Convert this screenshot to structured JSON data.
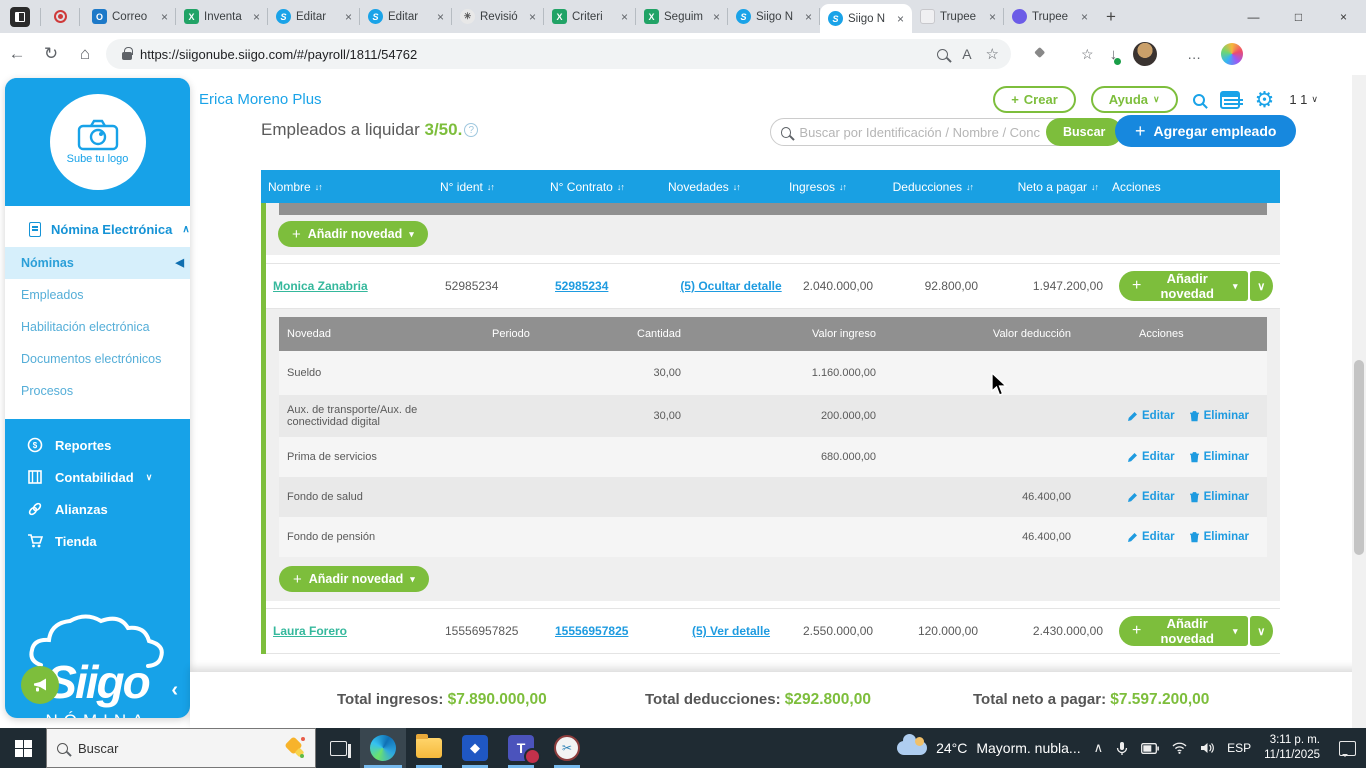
{
  "colors": {
    "siigo_blue": "#17A2E8",
    "siigo_green": "#7DBE3C",
    "table_header_blue": "#19A0E3",
    "detail_header_gray": "#909090",
    "link_blue": "#1E9BE0",
    "name_link_teal": "#35B89C",
    "agregar_button_blue": "#1788DE"
  },
  "browser": {
    "tabs": [
      {
        "label": "Correo"
      },
      {
        "label": "Inventa"
      },
      {
        "label": "Editar"
      },
      {
        "label": "Editar"
      },
      {
        "label": "Revisió"
      },
      {
        "label": "Criteri"
      },
      {
        "label": "Seguim"
      },
      {
        "label": "Siigo N"
      },
      {
        "label": "Siigo N"
      },
      {
        "label": "Trupee"
      },
      {
        "label": "Trupee"
      }
    ],
    "favicon_letters": {
      "outlook": "O",
      "excel": "X",
      "siigo": "S",
      "openai": "✳",
      "trupee_gray": "▣",
      "trupee_purple": "◉"
    },
    "url": "https://siigonube.siigo.com/#/payroll/1811/54762"
  },
  "header": {
    "company": "Erica Moreno Plus",
    "crear": "Crear",
    "ayuda": "Ayuda",
    "org_count": "1 1"
  },
  "toolbar": {
    "title": "Empleados a liquidar",
    "count": "3/50.",
    "search_placeholder": "Buscar por Identificación / Nombre / Conc",
    "buscar": "Buscar",
    "agregar": "Agregar empleado"
  },
  "table": {
    "headers": [
      "Nombre",
      "N° ident",
      "N° Contrato",
      "Novedades",
      "Ingresos",
      "Deducciones",
      "Neto a pagar",
      "Acciones"
    ],
    "add_novedad": "Añadir novedad",
    "rows": [
      {
        "name": "Monica Zanabria",
        "ident": "52985234",
        "contract": "52985234",
        "novelty": "(5) Ocultar detalle",
        "ingresos": "2.040.000,00",
        "deducciones": "92.800,00",
        "neto": "1.947.200,00"
      },
      {
        "name": "Laura Forero",
        "ident": "15556957825",
        "contract": "15556957825",
        "novelty": "(5) Ver detalle",
        "ingresos": "2.550.000,00",
        "deducciones": "120.000,00",
        "neto": "2.430.000,00"
      }
    ]
  },
  "detail": {
    "headers": [
      "Novedad",
      "Periodo",
      "Cantidad",
      "Valor ingreso",
      "Valor deducción",
      "Acciones"
    ],
    "rows": [
      {
        "name": "Sueldo",
        "qty": "30,00",
        "ingreso": "1.160.000,00",
        "deduccion": ""
      },
      {
        "name": "Aux. de transporte/Aux. de conectividad digital",
        "qty": "30,00",
        "ingreso": "200.000,00",
        "deduccion": ""
      },
      {
        "name": "Prima de servicios",
        "qty": "",
        "ingreso": "680.000,00",
        "deduccion": ""
      },
      {
        "name": "Fondo de salud",
        "qty": "",
        "ingreso": "",
        "deduccion": "46.400,00"
      },
      {
        "name": "Fondo de pensión",
        "qty": "",
        "ingreso": "",
        "deduccion": "46.400,00"
      }
    ],
    "editar": "Editar",
    "eliminar": "Eliminar"
  },
  "totals": {
    "ingresos_label": "Total ingresos:",
    "ingresos": "$7.890.000,00",
    "deducciones_label": "Total deducciones:",
    "deducciones": "$292.800,00",
    "neto_label": "Total neto a pagar:",
    "neto": "$7.597.200,00"
  },
  "sidebar": {
    "logo_placeholder": "Sube tu logo",
    "section": "Nómina Electrónica",
    "items": [
      "Nóminas",
      "Empleados",
      "Habilitación electrónica",
      "Documentos electrónicos",
      "Procesos"
    ],
    "lower_items": [
      "Reportes",
      "Contabilidad",
      "Alianzas",
      "Tienda"
    ],
    "brand": "Siigo",
    "brand_sub": "NÓMINA"
  },
  "taskbar": {
    "search": "Buscar",
    "weather_temp": "24°C",
    "weather_desc": "Mayorm. nubla...",
    "lang": "ESP",
    "time": "3:11 p. m.",
    "date": "11/11/2025"
  },
  "glyphs": {
    "close": "×",
    "plus": "+",
    "sort": "↓↑",
    "chevron_down": "∨",
    "chevron_up": "∧",
    "caret_down": "▾",
    "chevron_left": "‹",
    "back": "←",
    "refresh": "↻",
    "home": "⌂",
    "minimize": "—",
    "maximize": "□",
    "more": "…",
    "question": "?",
    "tri_left": "◀",
    "diamond": "◆",
    "star": "☆",
    "download": "↓",
    "readaloud": "A",
    "gear": "⚙",
    "dollar": "$",
    "teams": "T",
    "scissors": "✂"
  }
}
